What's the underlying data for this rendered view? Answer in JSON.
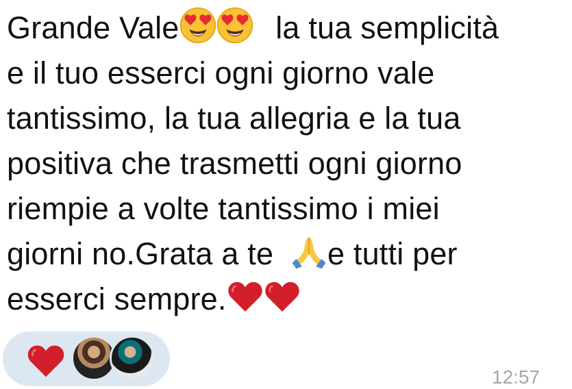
{
  "message": {
    "line1_a": "Grande Vale",
    "line1_b": " la tua semplicità",
    "line2": "e il tuo esserci ogni giorno vale",
    "line3": "tantissimo, la tua allegria e la tua",
    "line4": "positiva che trasmetti ogni giorno",
    "line5": "riempie a volte tantissimo i miei",
    "line6_a": "giorni no.Grata a te ",
    "line6_b": "e tutti per",
    "line7": "esserci sempre.",
    "emojis": [
      "smiling-face-with-heart-eyes",
      "smiling-face-with-heart-eyes",
      "folded-hands",
      "red-heart",
      "red-heart"
    ]
  },
  "reactions": {
    "emoji": "red-heart",
    "avatars": [
      "reactor-avatar-1",
      "reactor-avatar-2"
    ]
  },
  "timestamp": "12:57",
  "colors": {
    "text": "#111111",
    "reaction_pill": "#dde7f2",
    "timestamp": "#a7a7a7",
    "heart": "#d21f2b"
  }
}
